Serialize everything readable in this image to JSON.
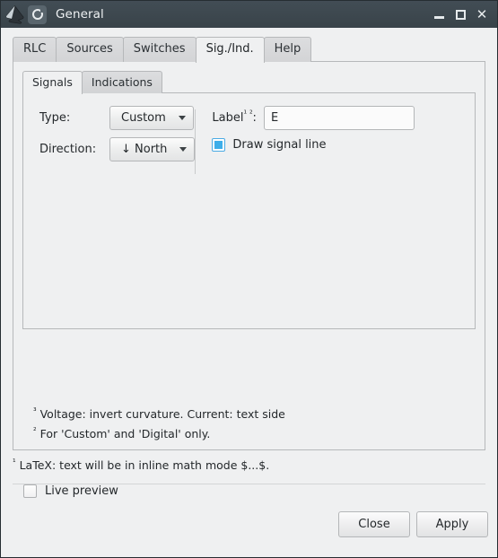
{
  "window": {
    "title": "General",
    "app_icon": "inkscape-logo",
    "dialog_icon": "circuitikz-icon",
    "controls": {
      "minimize": "minimize-icon",
      "maximize": "maximize-icon",
      "close": "close-icon"
    }
  },
  "tabs": [
    {
      "label": "RLC",
      "active": false
    },
    {
      "label": "Sources",
      "active": false
    },
    {
      "label": "Switches",
      "active": false
    },
    {
      "label": "Sig./Ind.",
      "active": true
    },
    {
      "label": "Help",
      "active": false
    }
  ],
  "inner_tabs": [
    {
      "label": "Signals",
      "active": true
    },
    {
      "label": "Indications",
      "active": false
    }
  ],
  "form": {
    "type": {
      "label": "Type:",
      "value": "Custom"
    },
    "direction": {
      "label": "Direction:",
      "value": "↓ North"
    },
    "label_field": {
      "label": "Label",
      "label_sup": "¹ ²",
      "label_suffix": ":",
      "value": "E",
      "placeholder": ""
    },
    "draw_signal_line": {
      "label": "Draw signal line",
      "checked": true
    }
  },
  "footnotes": {
    "inner": [
      {
        "marker": "³",
        "text": "Voltage: invert curvature. Current: text side"
      },
      {
        "marker": "²",
        "text": "For 'Custom' and 'Digital' only."
      }
    ],
    "outer": {
      "marker": "¹",
      "text": "LaTeX: text will be in inline math mode $...$."
    }
  },
  "bottom": {
    "live_preview": {
      "label": "Live preview",
      "checked": false
    },
    "close_label": "Close",
    "apply_label": "Apply"
  },
  "colors": {
    "titlebar": "#3c474e",
    "panel": "#eff0f1",
    "accent": "#3daee9",
    "border": "#b6b8ba",
    "text": "#24282b"
  }
}
